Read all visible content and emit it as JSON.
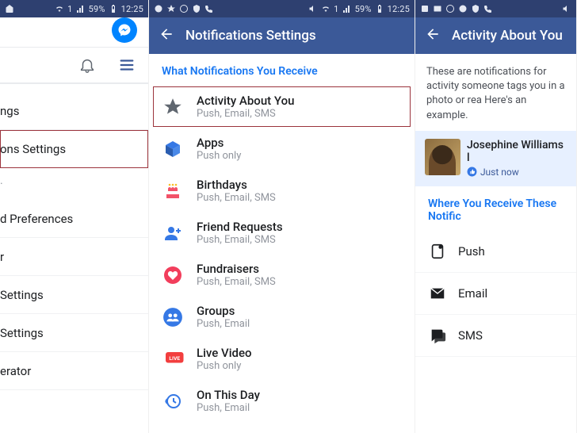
{
  "statusbar": {
    "battery": "59%",
    "time": "12:25",
    "signal": "1"
  },
  "screen1": {
    "items": [
      "ngs",
      "ons Settings",
      "d Preferences",
      "r",
      "Settings",
      "Settings",
      "erator"
    ]
  },
  "screen2": {
    "title": "Notifications Settings",
    "section": "What Notifications You Receive",
    "items": [
      {
        "title": "Activity About You",
        "sub": "Push, Email, SMS"
      },
      {
        "title": "Apps",
        "sub": "Push only"
      },
      {
        "title": "Birthdays",
        "sub": "Push, Email, SMS"
      },
      {
        "title": "Friend Requests",
        "sub": "Push, Email, SMS"
      },
      {
        "title": "Fundraisers",
        "sub": "Push, Email, SMS"
      },
      {
        "title": "Groups",
        "sub": "Push, Email"
      },
      {
        "title": "Live Video",
        "sub": "Push only"
      },
      {
        "title": "On This Day",
        "sub": "Push, Email"
      }
    ]
  },
  "screen3": {
    "title": "Activity About You",
    "desc": "These are notifications for activity someone tags you in a photo or rea Here's an example.",
    "notif": {
      "name": "Josephine Williams l",
      "time": "Just now"
    },
    "section": "Where You Receive These Notific",
    "channels": [
      "Push",
      "Email",
      "SMS"
    ]
  }
}
